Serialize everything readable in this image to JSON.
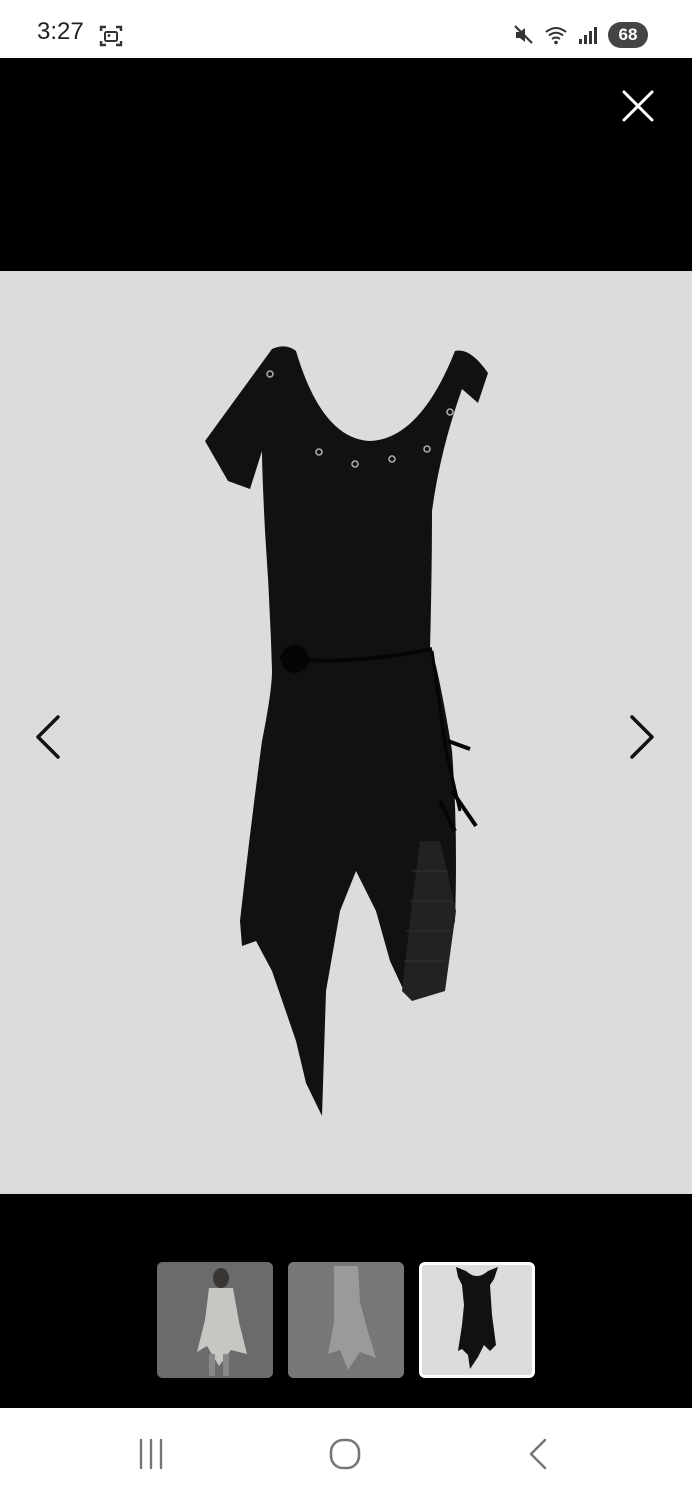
{
  "status_bar": {
    "time": "3:27",
    "battery": "68",
    "icons": [
      "screenshot-icon",
      "mute-icon",
      "wifi-icon",
      "signal-icon",
      "battery-icon"
    ]
  },
  "viewer": {
    "close_icon": "close-icon",
    "prev_icon": "chevron-left-icon",
    "next_icon": "chevron-right-icon",
    "stage_color": "#dcdcdc",
    "selected_thumbnail": 3,
    "thumbnails": [
      {
        "name": "thumbnail-model-white-dress"
      },
      {
        "name": "thumbnail-white-dress"
      },
      {
        "name": "thumbnail-black-dress"
      }
    ]
  },
  "system_nav": {
    "recents_icon": "recents-icon",
    "home_icon": "home-icon",
    "back_icon": "back-icon"
  }
}
